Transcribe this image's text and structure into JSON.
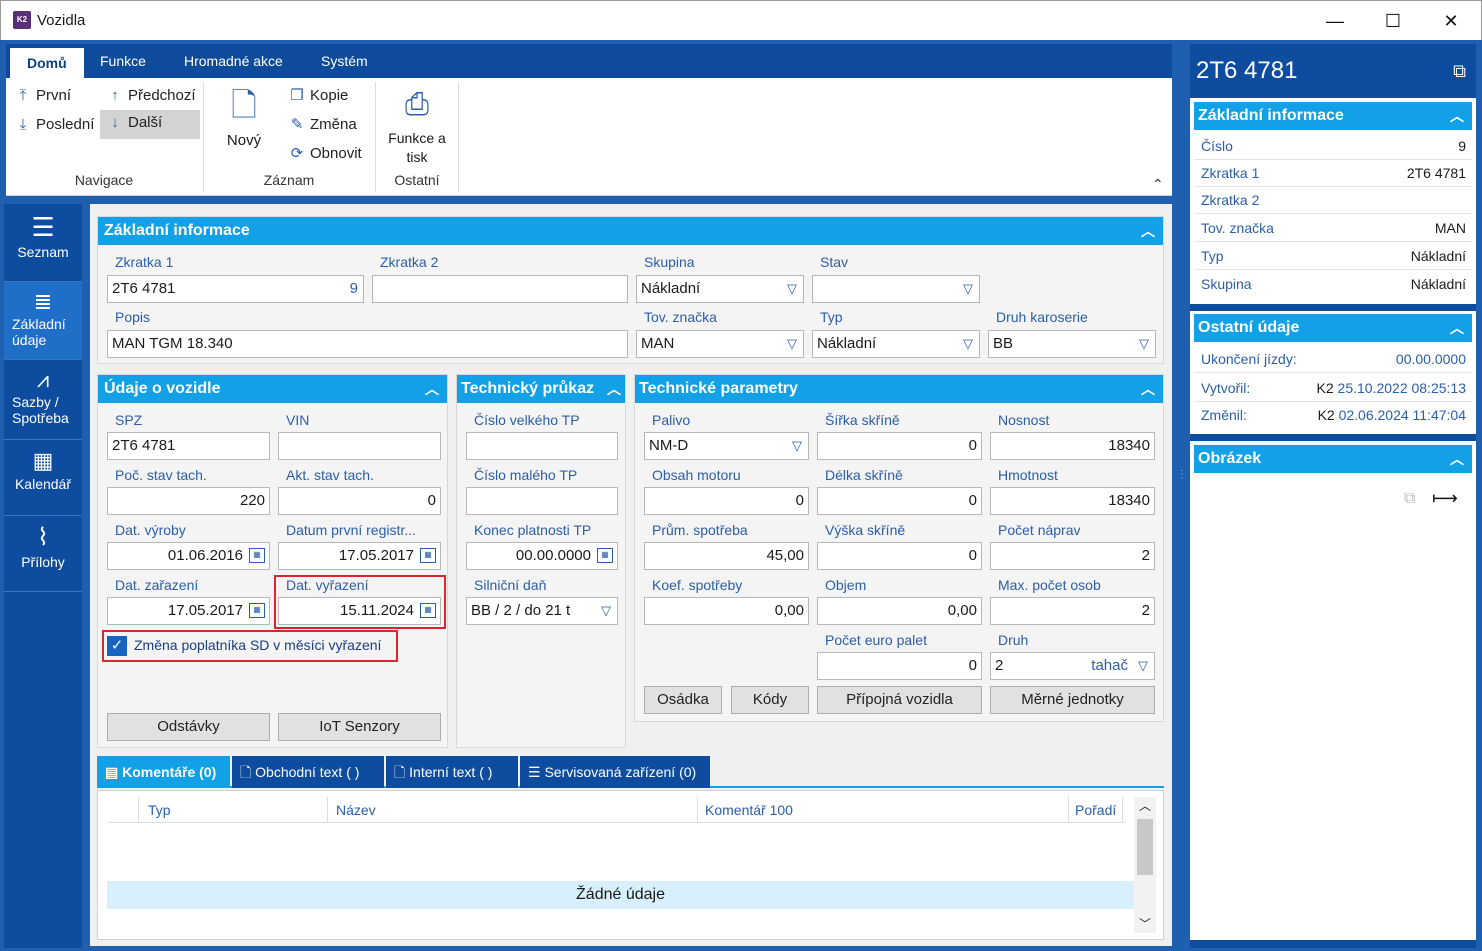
{
  "window": {
    "title": "Vozidla",
    "app_icon": "K2",
    "minimize": "—",
    "maximize": "☐",
    "close": "✕"
  },
  "ribbon": {
    "tabs": [
      "Domů",
      "Funkce",
      "Hromadné akce",
      "Systém"
    ],
    "nav": {
      "first": "První",
      "prev": "Předchozí",
      "last": "Poslední",
      "next": "Další",
      "group": "Navigace"
    },
    "record": {
      "new": "Nový",
      "copy": "Kopie",
      "change": "Změna",
      "refresh": "Obnovit",
      "group": "Záznam"
    },
    "other": {
      "print": "Funkce a tisk",
      "group": "Ostatní"
    }
  },
  "leftnav": [
    {
      "label": "Seznam",
      "icon": "list-icon"
    },
    {
      "label": "Základní údaje",
      "icon": "details-icon"
    },
    {
      "label": "Sazby / Spotřeba",
      "icon": "chart-icon"
    },
    {
      "label": "Kalendář",
      "icon": "calendar-icon"
    },
    {
      "label": "Přílohy",
      "icon": "paperclip-icon"
    }
  ],
  "basic": {
    "title": "Základní informace",
    "zkratka1_label": "Zkratka 1",
    "zkratka1": "2T6 4781",
    "zkratka1_num": "9",
    "zkratka2_label": "Zkratka 2",
    "zkratka2": "",
    "skupina_label": "Skupina",
    "skupina": "Nákladní",
    "stav_label": "Stav",
    "stav": "",
    "popis_label": "Popis",
    "popis": "MAN TGM 18.340",
    "znacka_label": "Tov. značka",
    "znacka": "MAN",
    "typ_label": "Typ",
    "typ": "Nákladní",
    "karoserie_label": "Druh karoserie",
    "karoserie": "BB"
  },
  "vehicle": {
    "title": "Údaje o vozidle",
    "spz_label": "SPZ",
    "spz": "2T6 4781",
    "vin_label": "VIN",
    "vin": "",
    "poc_tach_label": "Poč. stav tach.",
    "poc_tach": "220",
    "akt_tach_label": "Akt. stav tach.",
    "akt_tach": "0",
    "dat_vyroby_label": "Dat. výroby",
    "dat_vyroby": "01.06.2016",
    "prvni_reg_label": "Datum první registr...",
    "prvni_reg": "17.05.2017",
    "dat_zarazeni_label": "Dat. zařazení",
    "dat_zarazeni": "17.05.2017",
    "dat_vyrazeni_label": "Dat. vyřazení",
    "dat_vyrazeni": "15.11.2024",
    "checkbox_label": "Změna poplatníka SD v měsíci vyřazení",
    "odstavky": "Odstávky",
    "iot": "IoT Senzory"
  },
  "tp": {
    "title": "Technický průkaz",
    "velky_label": "Číslo velkého TP",
    "velky": "",
    "maly_label": "Číslo malého TP",
    "maly": "",
    "konec_label": "Konec platnosti TP",
    "konec": "00.00.0000",
    "dan_label": "Silniční daň",
    "dan": "BB / 2 / do 21 t"
  },
  "tech": {
    "title": "Technické parametry",
    "palivo_label": "Palivo",
    "palivo": "NM-D",
    "sirka_label": "Šířka skříně",
    "sirka": "0",
    "nosnost_label": "Nosnost",
    "nosnost": "18340",
    "obsah_label": "Obsah motoru",
    "obsah": "0",
    "delka_label": "Délka skříně",
    "delka": "0",
    "hmotnost_label": "Hmotnost",
    "hmotnost": "18340",
    "prum_label": "Prům. spotřeba",
    "prum": "45,00",
    "vyska_label": "Výška skříně",
    "vyska": "0",
    "napravy_label": "Počet náprav",
    "napravy": "2",
    "koef_label": "Koef. spotřeby",
    "koef": "0,00",
    "objem_label": "Objem",
    "objem": "0,00",
    "osoby_label": "Max. počet osob",
    "osoby": "2",
    "palety_label": "Počet euro palet",
    "palety": "0",
    "druh_label": "Druh",
    "druh": "2",
    "druh_text": "tahač",
    "osadka": "Osádka",
    "kody": "Kódy",
    "pripojna": "Přípojná vozidla",
    "merne": "Měrné jednotky"
  },
  "bottom_tabs": [
    "Komentáře (0)",
    "Obchodní text ( )",
    "Interní text ( )",
    "Servisovaná zařízení (0)"
  ],
  "grid": {
    "columns": [
      "Typ",
      "Název",
      "Komentář 100",
      "Pořadí"
    ],
    "empty": "Žádné údaje"
  },
  "right": {
    "title": "2T6 4781",
    "basic_title": "Základní informace",
    "basic_rows": [
      {
        "k": "Číslo",
        "v": "9"
      },
      {
        "k": "Zkratka 1",
        "v": "2T6 4781"
      },
      {
        "k": "Zkratka 2",
        "v": ""
      },
      {
        "k": "Tov. značka",
        "v": "MAN"
      },
      {
        "k": "Typ",
        "v": "Nákladní"
      },
      {
        "k": "Skupina",
        "v": "Nákladní"
      }
    ],
    "other_title": "Ostatní údaje",
    "ukonceni_label": "Ukončení jízdy:",
    "ukonceni": "00.00.0000",
    "vytvoril_label": "Vytvořil:",
    "vytvoril_user": "K2",
    "vytvoril": "25.10.2022 08:25:13",
    "zmenil_label": "Změnil:",
    "zmenil_user": "K2",
    "zmenil": "02.06.2024 11:47:04",
    "image_title": "Obrázek"
  }
}
